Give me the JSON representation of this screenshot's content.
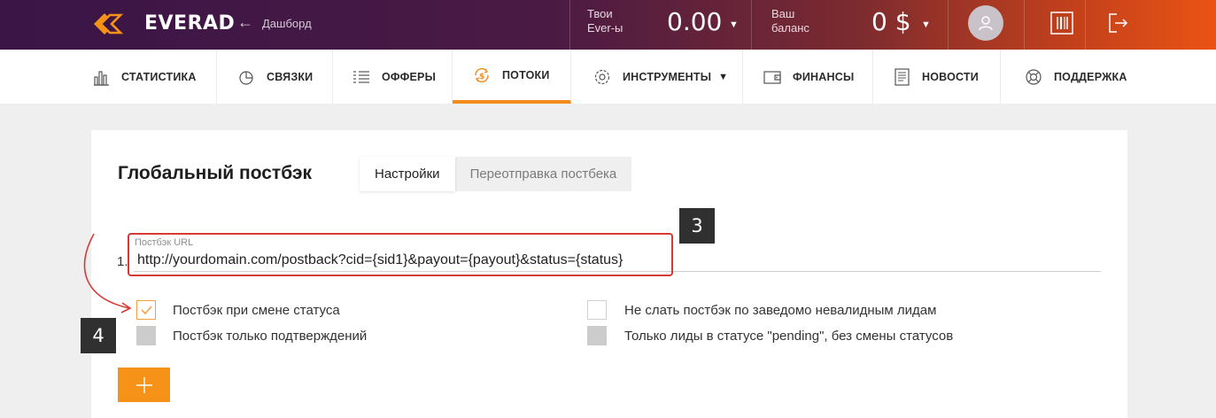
{
  "header": {
    "logo_text": "EVERAD",
    "breadcrumb": "Дашборд",
    "ever_label_1": "Твои",
    "ever_label_2": "Ever-ы",
    "ever_value": "0.00",
    "balance_label_1": "Ваш",
    "balance_label_2": "баланс",
    "balance_value": "0 $"
  },
  "nav": {
    "items": [
      {
        "label": "СТАТИСТИКА",
        "icon": "bar-chart-icon"
      },
      {
        "label": "СВЯЗКИ",
        "icon": "pie-chart-icon"
      },
      {
        "label": "ОФФЕРЫ",
        "icon": "list-icon"
      },
      {
        "label": "ПОТОКИ",
        "icon": "money-cycle-icon",
        "active": true
      },
      {
        "label": "ИНСТРУМЕНТЫ",
        "icon": "gear-icon",
        "has_dropdown": true
      },
      {
        "label": "ФИНАНСЫ",
        "icon": "wallet-icon"
      },
      {
        "label": "НОВОСТИ",
        "icon": "newspaper-icon"
      },
      {
        "label": "ПОДДЕРЖКА",
        "icon": "lifebuoy-icon"
      }
    ]
  },
  "card": {
    "title": "Глобальный постбэк",
    "tabs": [
      {
        "label": "Настройки",
        "active": true
      },
      {
        "label": "Переотправка постбека",
        "active": false
      }
    ],
    "row_number": "1.",
    "url_label": "Постбэк URL",
    "url_value": "http://yourdomain.com/postback?cid={sid1}&payout={payout}&status={status}",
    "checkboxes": [
      {
        "label": "Постбэк при смене статуса",
        "checked": true
      },
      {
        "label": "Не слать постбэк по заведомо невалидным лидам",
        "checked": false
      },
      {
        "label": "Постбэк только подтверждений",
        "checked": false,
        "disabled": true
      },
      {
        "label": "Только лиды в статусе \"pending\", без смены статусов",
        "checked": false,
        "disabled": true
      }
    ],
    "add_button_label": "+"
  },
  "annotations": {
    "marker_3": "3",
    "marker_4": "4"
  },
  "colors": {
    "accent": "#f59217",
    "active_tab_underline": "#f28c1d",
    "highlight": "#d63a35"
  }
}
